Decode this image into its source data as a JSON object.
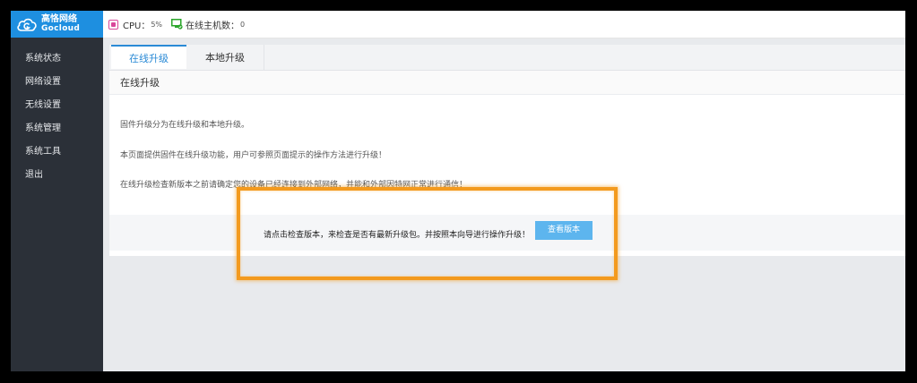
{
  "logo": {
    "cn": "高恪网络",
    "en": "Gocloud"
  },
  "sidebar": {
    "items": [
      {
        "label": "系统状态"
      },
      {
        "label": "网络设置"
      },
      {
        "label": "无线设置"
      },
      {
        "label": "系统管理"
      },
      {
        "label": "系统工具"
      },
      {
        "label": "退出"
      }
    ]
  },
  "status": {
    "cpu_label": "CPU：",
    "cpu_value": "5%",
    "hosts_label": "在线主机数：",
    "hosts_value": "0"
  },
  "tabs": [
    {
      "label": "在线升级",
      "active": true
    },
    {
      "label": "本地升级",
      "active": false
    }
  ],
  "section_title": "在线升级",
  "descriptions": [
    "固件升级分为在线升级和本地升级。",
    "本页面提供固件在线升级功能，用户可参照页面提示的操作方法进行升级！",
    "在线升级检查新版本之前请确定您的设备已经连接到外部网络，并能和外部因特网正常进行通信！"
  ],
  "check": {
    "prompt": "请点击检查版本，来检查是否有最新升级包。并按照本向导进行操作升级！",
    "button_label": "查看版本"
  },
  "colors": {
    "sidebar_bg": "#2b3038",
    "logo_bg": "#1e8fe0",
    "accent": "#2a8ad6",
    "button_bg": "#5db5ee",
    "highlight": "#f39a1e"
  }
}
